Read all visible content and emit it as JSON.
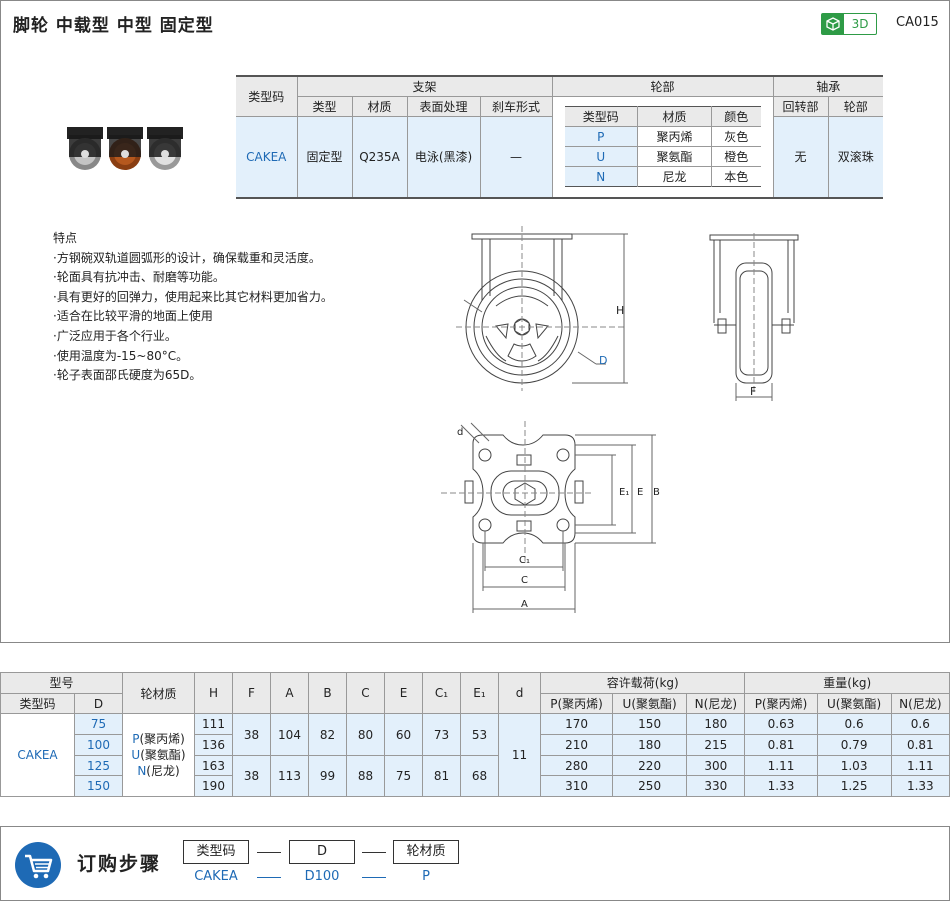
{
  "header": {
    "title": "脚轮  中载型  中型  固定型",
    "badge": "3D",
    "code": "CA015"
  },
  "spec": {
    "h_typecode": "类型码",
    "h_bracket": "支架",
    "h_wheel": "轮部",
    "h_bearing": "轴承",
    "h_type": "类型",
    "h_material": "材质",
    "h_surface": "表面处理",
    "h_brake": "刹车形式",
    "h_swivel": "回转部",
    "h_wheelpart": "轮部",
    "typecode": "CAKEA",
    "type": "固定型",
    "material": "Q235A",
    "surface": "电泳(黑漆)",
    "brake": "—",
    "swivel": "无",
    "wheelbearing": "双滚珠",
    "wheel_hdr": [
      "类型码",
      "材质",
      "颜色"
    ],
    "wheel_rows": [
      [
        "P",
        "聚丙烯",
        "灰色"
      ],
      [
        "U",
        "聚氨酯",
        "橙色"
      ],
      [
        "N",
        "尼龙",
        "本色"
      ]
    ]
  },
  "features": {
    "title": "特点",
    "items": [
      "·方钢碗双轨道圆弧形的设计，确保载重和灵活度。",
      "·轮面具有抗冲击、耐磨等功能。",
      "·具有更好的回弹力，使用起来比其它材料更加省力。",
      "·适合在比较平滑的地面上使用",
      "·广泛应用于各个行业。",
      "·使用温度为-15~80°C。",
      "·轮子表面邵氏硬度为65D。"
    ]
  },
  "drawing": {
    "H": "H",
    "D": "D",
    "F": "F",
    "d": "d",
    "E1": "E₁",
    "E": "E",
    "B": "B",
    "C1": "C₁",
    "C": "C",
    "A": "A"
  },
  "table": {
    "h_model": "型号",
    "h_typecode": "类型码",
    "h_D": "D",
    "h_wheelmat": "轮材质",
    "h_H": "H",
    "h_F": "F",
    "h_A": "A",
    "h_B": "B",
    "h_C": "C",
    "h_E": "E",
    "h_C1": "C₁",
    "h_E1": "E₁",
    "h_d": "d",
    "h_load": "容许载荷(kg)",
    "h_weight": "重量(kg)",
    "h_P": "P(聚丙烯)",
    "h_U": "U(聚氨酯)",
    "h_N": "N(尼龙)",
    "typecode": "CAKEA",
    "mat_P": "P",
    "mat_P_name": "(聚丙烯)",
    "mat_U": "U",
    "mat_U_name": "(聚氨酯)",
    "mat_N": "N",
    "mat_N_name": "(尼龙)",
    "d": "11",
    "group1": {
      "F": "38",
      "A": "104",
      "B": "82",
      "C": "80",
      "E": "60",
      "C1": "73",
      "E1": "53"
    },
    "group2": {
      "F": "38",
      "A": "113",
      "B": "99",
      "C": "88",
      "E": "75",
      "C1": "81",
      "E1": "68"
    },
    "rows": [
      {
        "D": "75",
        "H": "111",
        "lP": "170",
        "lU": "150",
        "lN": "180",
        "wP": "0.63",
        "wU": "0.6",
        "wN": "0.6"
      },
      {
        "D": "100",
        "H": "136",
        "lP": "210",
        "lU": "180",
        "lN": "215",
        "wP": "0.81",
        "wU": "0.79",
        "wN": "0.81"
      },
      {
        "D": "125",
        "H": "163",
        "lP": "280",
        "lU": "220",
        "lN": "300",
        "wP": "1.11",
        "wU": "1.03",
        "wN": "1.11"
      },
      {
        "D": "150",
        "H": "190",
        "lP": "310",
        "lU": "250",
        "lN": "330",
        "wP": "1.33",
        "wU": "1.25",
        "wN": "1.33"
      }
    ]
  },
  "order": {
    "title": "订购步骤",
    "boxes": [
      "类型码",
      "D",
      "轮材质"
    ],
    "values": [
      "CAKEA",
      "D100",
      "P"
    ]
  },
  "colors": {
    "accent": "#1e6ab5",
    "header_bg": "#eaeaea",
    "cell_bg": "#e3f0fb",
    "badge": "#2e9b46"
  }
}
